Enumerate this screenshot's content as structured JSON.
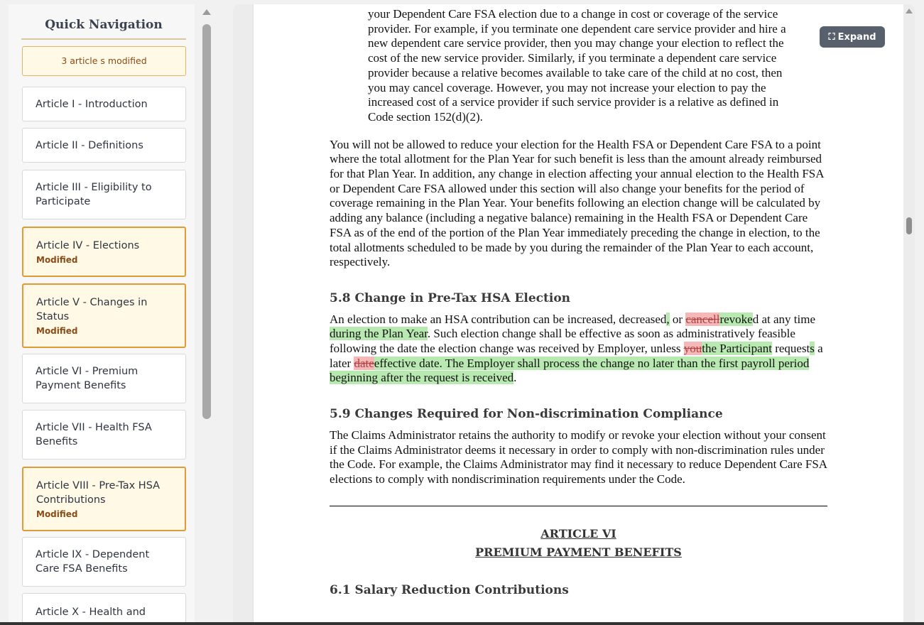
{
  "sidebar": {
    "title": "Quick Navigation",
    "modified_summary": "3 article s modified",
    "modified_badge": "Modified",
    "items": [
      {
        "label": "Article I - Introduction",
        "modified": false
      },
      {
        "label": "Article II - Definitions",
        "modified": false
      },
      {
        "label": "Article III - Eligibility to Participate",
        "modified": false
      },
      {
        "label": "Article IV - Elections",
        "modified": true
      },
      {
        "label": "Article V - Changes in Status",
        "modified": true
      },
      {
        "label": "Article VI - Premium Payment Benefits",
        "modified": false
      },
      {
        "label": "Article VII - Health FSA Benefits",
        "modified": false
      },
      {
        "label": "Article VIII - Pre-Tax HSA Contributions",
        "modified": true
      },
      {
        "label": "Article IX - Dependent Care FSA Benefits",
        "modified": false
      },
      {
        "label": "Article X - Health and",
        "modified": false
      }
    ]
  },
  "toolbar": {
    "expand_label": "Expand"
  },
  "document": {
    "para_top": {
      "l1": "your Dependent Care FSA election due to a change in cost or coverage of the service",
      "l2": "provider. For example, if you terminate one dependent care service provider and hire a",
      "l3": "new dependent care service provider, then you may change your election to reflect the",
      "l4": "cost of the new service provider. Similarly, if you terminate a dependent care service",
      "l5": "provider because a relative becomes available to take care of the child at no cost, then",
      "l6": "you may cancel coverage. However, you may not increase your election to pay the",
      "l7": "increased cost of a service provider if such service provider is a relative as defined in",
      "l8": "Code section 152(d)(2)."
    },
    "para_reduce": "You will not be allowed to reduce your election for the Health FSA or Dependent Care FSA to a point where the total allotment for the Plan Year for such benefit is less than the amount already reimbursed for that Plan Year. In addition, any change in election affecting your annual election to the Health FSA or Dependent Care FSA allowed under this section will also change your benefits for the period of coverage remaining in the Plan Year. Your benefits following an election change will be calculated by adding any balance (including a negative balance) remaining in the Health FSA or Dependent Care FSA as of the end of the portion of the Plan Year immediately preceding the change in election, to the total allotments scheduled to be made by you during the remainder of the Plan Year to each account, respectively.",
    "sec58": {
      "heading": "5.8 Change in Pre-Tax HSA Election",
      "t1": "An election to make an HSA contribution can be increased, decreased",
      "i1": ",",
      "t2": " or ",
      "d1": "cancell",
      "i2": "revoke",
      "t3": "d at any time",
      "i3": " during the Plan Year",
      "t4": ". Such election change shall be effective as soon as administratively feasible following the date the election change was received by Employer, unless ",
      "d2": "you",
      "i4": "the Participant",
      "t5": " request",
      "i5": "s",
      "t6": " a later ",
      "d3": "date",
      "i6": "effective date. The Employer shall process the change no later than the first payroll period beginning after the request is received",
      "t7": "."
    },
    "sec59": {
      "heading": "5.9 Changes Required for Non-discrimination Compliance",
      "body": "The Claims Administrator retains the authority to modify or revoke your election without your consent if the Claims Administrator deems it necessary in order to comply with non-discrimination rules under the Code. For example, the Claims Administrator may find it necessary to reduce Dependent Care FSA elections to comply with nondiscrimination requirements under the Code."
    },
    "article6": {
      "number": "ARTICLE VI",
      "title": "PREMIUM PAYMENT BENEFITS"
    },
    "sec61": {
      "heading": "6.1 Salary Reduction Contributions"
    }
  }
}
